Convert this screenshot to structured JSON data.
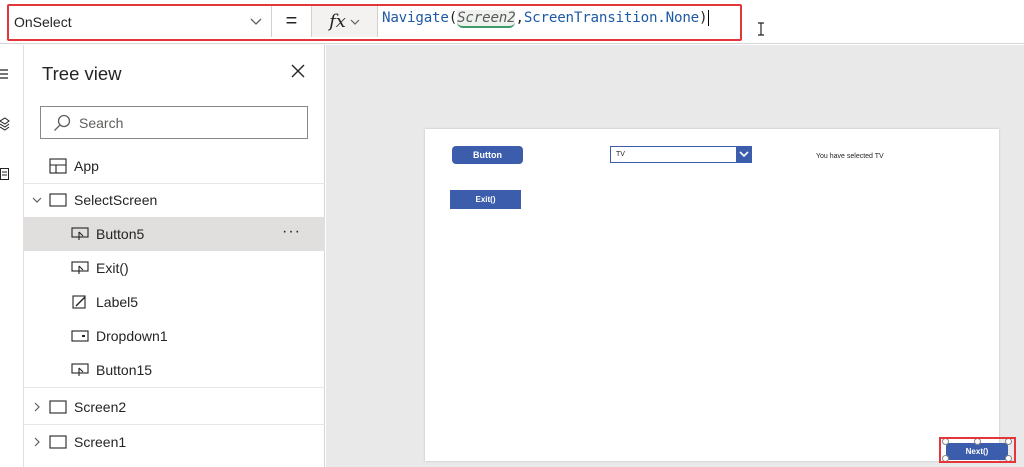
{
  "formula_bar": {
    "property": "OnSelect",
    "equals": "=",
    "fx": "fx",
    "formula": {
      "fn": "Navigate",
      "open": "(",
      "arg1": "Screen2",
      "comma": ",",
      "arg2": "ScreenTransition.None",
      "close": ")"
    }
  },
  "tree_view": {
    "title": "Tree view",
    "search_placeholder": "Search",
    "items": [
      {
        "label": "App",
        "icon": "app-icon"
      },
      {
        "label": "SelectScreen",
        "icon": "screen-icon"
      },
      {
        "label": "Button5",
        "icon": "button-icon",
        "selected": true
      },
      {
        "label": "Exit()",
        "icon": "button-icon"
      },
      {
        "label": "Label5",
        "icon": "label-icon"
      },
      {
        "label": "Dropdown1",
        "icon": "dropdown-icon"
      },
      {
        "label": "Button15",
        "icon": "button-icon"
      },
      {
        "label": "Screen2",
        "icon": "screen-icon"
      },
      {
        "label": "Screen1",
        "icon": "screen-icon"
      }
    ],
    "more": "···"
  },
  "canvas": {
    "button_text": "Button",
    "dropdown_value": "TV",
    "label_text": "You have selected TV",
    "exit_text": "Exit()",
    "next_text": "Next()"
  },
  "colors": {
    "accent": "#3c5dab",
    "highlight": "#e3363a",
    "selected_row": "#e1dfdd"
  }
}
